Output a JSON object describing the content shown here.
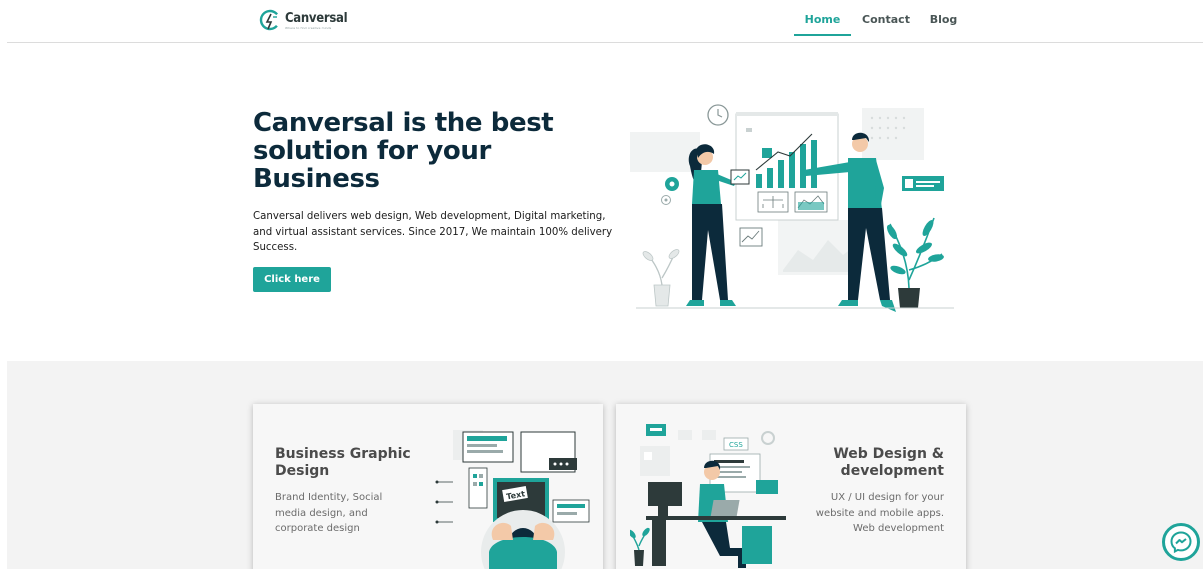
{
  "brand": {
    "name": "Canversal",
    "tagline": "Where to find creative minds",
    "accent": "#1fa49a",
    "dark": "#0c2a3b"
  },
  "nav": {
    "items": [
      {
        "label": "Home",
        "active": true
      },
      {
        "label": "Contact",
        "active": false
      },
      {
        "label": "Blog",
        "active": false
      }
    ]
  },
  "hero": {
    "title": "Canversal is the best solution for your Business",
    "description": "Canversal delivers web design, Web development, Digital marketing, and virtual assistant services. Since 2017, We maintain  100%  delivery Success.",
    "button_label": "Click here"
  },
  "services": {
    "cards": [
      {
        "title": "Business Graphic Design",
        "text": "Brand Identity, Social media design, and corporate design",
        "illustration_labels": [
          "Text"
        ]
      },
      {
        "title": "Web Design & development",
        "text": "UX / UI design for your website and mobile apps. Web development",
        "illustration_labels": [
          "CSS"
        ]
      }
    ]
  },
  "icons": {
    "logo": "canversal-logo-icon",
    "messenger": "messenger-icon"
  }
}
